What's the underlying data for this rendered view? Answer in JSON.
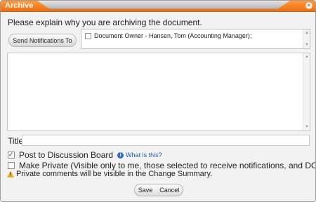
{
  "window": {
    "title": "Archive",
    "close_symbol": "×"
  },
  "instruction": "Please explain why you are archiving the document.",
  "notifications": {
    "button_label": "Send Notifications To",
    "recipient": "Document Owner - Hansen, Tom (Accounting Manager);",
    "recipient_checked": false
  },
  "comments": {
    "value": ""
  },
  "fields": {
    "title_label": "Title",
    "title_value": ""
  },
  "options": {
    "post_label": "Post to Discussion Board",
    "post_checked": true,
    "help_link": "What is this?",
    "private_label": "Make Private (Visible only to me, those selected to receive notifications, and DCAs.)",
    "private_checked": false
  },
  "warning": "Private comments will be visible in the Change Summary.",
  "actions": {
    "save_label": "Save",
    "cancel_label": "Cancel"
  },
  "icons": {
    "close": "close-icon",
    "checkbox": "checkbox-icon",
    "info": "info-icon",
    "warning": "warning-icon",
    "scroll_up": "chevron-up-icon",
    "scroll_down": "chevron-down-icon"
  },
  "colors": {
    "title_bar": "#ef6e10",
    "link": "#205fae",
    "warning": "#f0a81d"
  }
}
